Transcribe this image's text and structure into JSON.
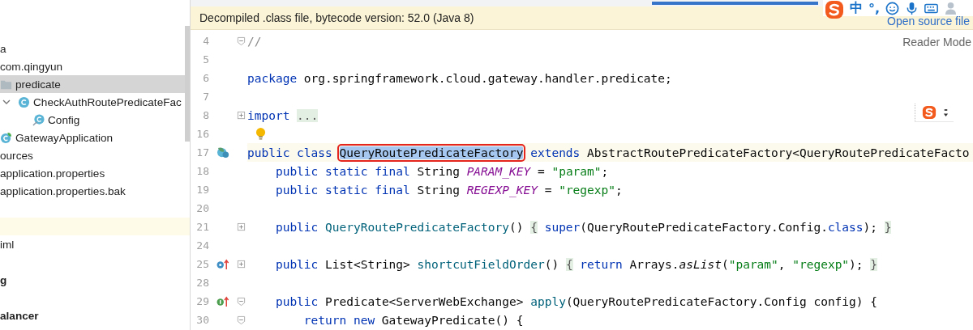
{
  "project_tree": {
    "items": [
      {
        "label": "a",
        "selected": false,
        "children": [
          {
            "label": "com.qingyun",
            "selected": false,
            "children": [
              {
                "label": "predicate",
                "kind": "folder",
                "selected": true,
                "children": [
                  {
                    "label": "CheckAuthRoutePredicateFac",
                    "kind": "class",
                    "expanded": true,
                    "selected": false,
                    "children": [
                      {
                        "label": "Config",
                        "kind": "inner-class",
                        "selected": false
                      }
                    ]
                  }
                ]
              },
              {
                "label": "GatewayApplication",
                "kind": "spring-class",
                "selected": false
              }
            ]
          }
        ]
      },
      {
        "label": "ources",
        "selected": false,
        "children": [
          {
            "label": "application.properties",
            "selected": false
          },
          {
            "label": "application.properties.bak",
            "selected": false
          }
        ]
      },
      {
        "label": "iml",
        "selected": false
      },
      {
        "label": "g",
        "kind": "module",
        "selected": false
      },
      {
        "label": "alancer",
        "kind": "module",
        "selected": false
      }
    ]
  },
  "ime_toolbar": {
    "chinese_mode": "中",
    "punctuation": "°,"
  },
  "banner": {
    "message": "Decompiled .class file, bytecode version: 52.0 (Java 8)",
    "link": "Open source file"
  },
  "reader_mode": "Reader Mode",
  "editor": {
    "lines": [
      {
        "n": "4",
        "fold": {
          "kind": "start"
        },
        "current": false,
        "tokens": [
          {
            "kind": "comment",
            "t": "//"
          }
        ]
      },
      {
        "n": "5",
        "current": false
      },
      {
        "n": "6",
        "current": false,
        "tokens": [
          {
            "kind": "keyword",
            "t": "package "
          },
          {
            "kind": "plain",
            "t": "org.springframework.cloud.gateway.handler.predicate;"
          }
        ]
      },
      {
        "n": "7",
        "current": false
      },
      {
        "n": "8",
        "fold": {
          "kind": "collapsed"
        },
        "current": false,
        "tokens": [
          {
            "kind": "keyword",
            "t": "import "
          },
          {
            "kind": "folded",
            "t": "..."
          }
        ]
      },
      {
        "n": "16",
        "intention": {
          "kind": "bulb"
        },
        "current": false
      },
      {
        "n": "17",
        "marker": {
          "kind": "class"
        },
        "current": true,
        "tokens": [
          {
            "kind": "keyword",
            "t": "public class "
          },
          {
            "kind": "boxed",
            "t": "QueryRoutePredicateFactory"
          },
          {
            "kind": "keyword",
            "t": " extends"
          },
          {
            "kind": "plain",
            "t": " AbstractRoutePredicateFactory<QueryRoutePredicateFacto"
          }
        ]
      },
      {
        "n": "18",
        "current": false,
        "tokens": [
          {
            "kind": "keyword",
            "t": "    public static final"
          },
          {
            "kind": "plain",
            "t": " String "
          },
          {
            "kind": "constant",
            "t": "PARAM_KEY"
          },
          {
            "kind": "plain",
            "t": " = "
          },
          {
            "kind": "string",
            "t": "\"param\""
          },
          {
            "kind": "plain",
            "t": ";"
          }
        ]
      },
      {
        "n": "19",
        "current": false,
        "tokens": [
          {
            "kind": "keyword",
            "t": "    public static final"
          },
          {
            "kind": "plain",
            "t": " String "
          },
          {
            "kind": "constant",
            "t": "REGEXP_KEY"
          },
          {
            "kind": "plain",
            "t": " = "
          },
          {
            "kind": "string",
            "t": "\"regexp\""
          },
          {
            "kind": "plain",
            "t": ";"
          }
        ]
      },
      {
        "n": "20",
        "current": false
      },
      {
        "n": "21",
        "fold": {
          "kind": "collapsed"
        },
        "current": false,
        "tokens": [
          {
            "kind": "keyword",
            "t": "    public "
          },
          {
            "kind": "method",
            "t": "QueryRoutePredicateFactory"
          },
          {
            "kind": "plain",
            "t": "() "
          },
          {
            "kind": "folded",
            "t": "{"
          },
          {
            "kind": "keyword",
            "t": " super"
          },
          {
            "kind": "plain",
            "t": "(QueryRoutePredicateFactory.Config."
          },
          {
            "kind": "keyword",
            "t": "class"
          },
          {
            "kind": "plain",
            "t": "); "
          },
          {
            "kind": "folded",
            "t": "}"
          }
        ]
      },
      {
        "n": "24",
        "current": false
      },
      {
        "n": "25",
        "marker": {
          "kind": "override"
        },
        "fold": {
          "kind": "collapsed"
        },
        "current": false,
        "tokens": [
          {
            "kind": "keyword",
            "t": "    public"
          },
          {
            "kind": "plain",
            "t": " List<String> "
          },
          {
            "kind": "method",
            "t": "shortcutFieldOrder"
          },
          {
            "kind": "plain",
            "t": "() "
          },
          {
            "kind": "folded",
            "t": "{"
          },
          {
            "kind": "keyword",
            "t": " return"
          },
          {
            "kind": "plain",
            "t": " Arrays."
          },
          {
            "kind": "static",
            "t": "asList"
          },
          {
            "kind": "plain",
            "t": "("
          },
          {
            "kind": "string",
            "t": "\"param\""
          },
          {
            "kind": "plain",
            "t": ", "
          },
          {
            "kind": "string",
            "t": "\"regexp\""
          },
          {
            "kind": "plain",
            "t": "); "
          },
          {
            "kind": "folded",
            "t": "}"
          }
        ]
      },
      {
        "n": "28",
        "current": false
      },
      {
        "n": "29",
        "marker": {
          "kind": "implements"
        },
        "fold": {
          "kind": "start"
        },
        "current": false,
        "tokens": [
          {
            "kind": "keyword",
            "t": "    public"
          },
          {
            "kind": "plain",
            "t": " Predicate<ServerWebExchange> "
          },
          {
            "kind": "method",
            "t": "apply"
          },
          {
            "kind": "plain",
            "t": "(QueryRoutePredicateFactory.Config config) {"
          }
        ]
      },
      {
        "n": "30",
        "fold": {
          "kind": "start"
        },
        "current": false,
        "tokens": [
          {
            "kind": "keyword",
            "t": "        return new"
          },
          {
            "kind": "plain",
            "t": " GatewayPredicate() {"
          }
        ]
      }
    ]
  }
}
